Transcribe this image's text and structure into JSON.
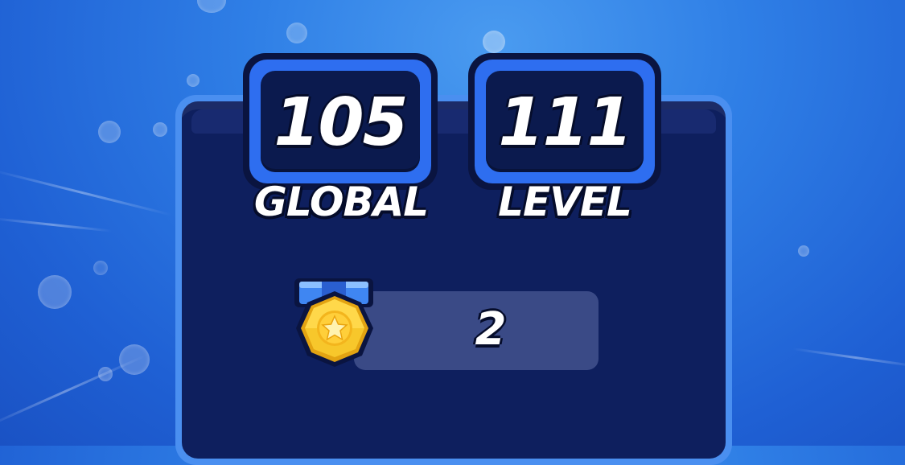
{
  "stats": {
    "global_value": "105",
    "global_label": "GLOBAL",
    "level_value": "111",
    "level_label": "LEVEL"
  },
  "medals": {
    "count": "2",
    "icon": "gold-star-medal-icon"
  },
  "colors": {
    "background": "#2f7fe6",
    "panel": "#0e1f5e",
    "badge_ring": "#2e6ef0",
    "medal_gold": "#f7c72b"
  }
}
